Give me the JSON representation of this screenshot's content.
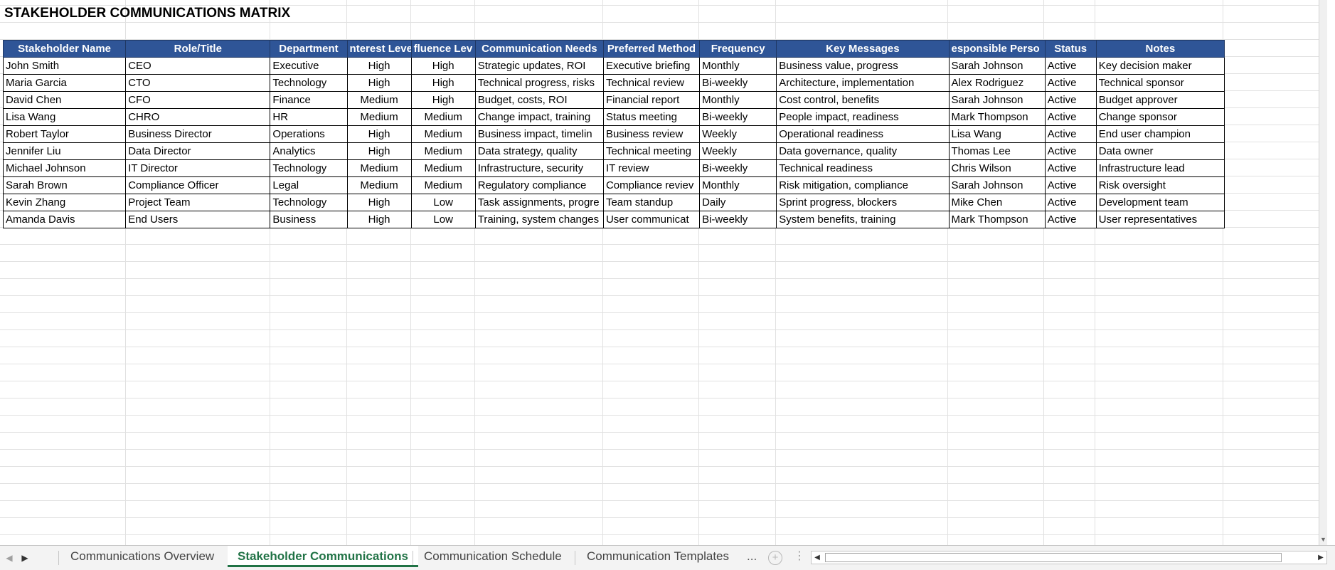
{
  "sheet": {
    "title": "STAKEHOLDER COMMUNICATIONS MATRIX",
    "header_color": "#2f5597",
    "columns": [
      "Stakeholder Name",
      "Role/Title",
      "Department",
      "nterest Leve",
      "fluence Lev",
      "Communication Needs",
      "Preferred Method",
      "Frequency",
      "Key Messages",
      "esponsible Perso",
      "Status",
      "Notes"
    ],
    "rows": [
      [
        "John Smith",
        "CEO",
        "Executive",
        "High",
        "High",
        "Strategic updates, ROI",
        "Executive briefing",
        "Monthly",
        "Business value, progress",
        "Sarah Johnson",
        "Active",
        "Key decision maker"
      ],
      [
        "Maria Garcia",
        "CTO",
        "Technology",
        "High",
        "High",
        "Technical progress, risks",
        "Technical review",
        "Bi-weekly",
        "Architecture, implementation",
        "Alex Rodriguez",
        "Active",
        "Technical sponsor"
      ],
      [
        "David Chen",
        "CFO",
        "Finance",
        "Medium",
        "High",
        "Budget, costs, ROI",
        "Financial report",
        "Monthly",
        "Cost control, benefits",
        "Sarah Johnson",
        "Active",
        "Budget approver"
      ],
      [
        "Lisa Wang",
        "CHRO",
        "HR",
        "Medium",
        "Medium",
        "Change impact, training",
        "Status meeting",
        "Bi-weekly",
        "People impact, readiness",
        "Mark Thompson",
        "Active",
        "Change sponsor"
      ],
      [
        "Robert Taylor",
        "Business Director",
        "Operations",
        "High",
        "Medium",
        "Business impact, timelin",
        "Business review",
        "Weekly",
        "Operational readiness",
        "Lisa Wang",
        "Active",
        "End user champion"
      ],
      [
        "Jennifer Liu",
        "Data Director",
        "Analytics",
        "High",
        "Medium",
        "Data strategy, quality",
        "Technical meeting",
        "Weekly",
        "Data governance, quality",
        "Thomas Lee",
        "Active",
        "Data owner"
      ],
      [
        "Michael Johnson",
        "IT Director",
        "Technology",
        "Medium",
        "Medium",
        "Infrastructure, security",
        "IT review",
        "Bi-weekly",
        "Technical readiness",
        "Chris Wilson",
        "Active",
        "Infrastructure lead"
      ],
      [
        "Sarah Brown",
        "Compliance Officer",
        "Legal",
        "Medium",
        "Medium",
        "Regulatory compliance",
        "Compliance reviev",
        "Monthly",
        "Risk mitigation, compliance",
        "Sarah Johnson",
        "Active",
        "Risk oversight"
      ],
      [
        "Kevin Zhang",
        "Project Team",
        "Technology",
        "High",
        "Low",
        "Task assignments, progre",
        "Team standup",
        "Daily",
        "Sprint progress, blockers",
        "Mike Chen",
        "Active",
        "Development team"
      ],
      [
        "Amanda Davis",
        "End Users",
        "Business",
        "High",
        "Low",
        "Training, system changes",
        "User communicat",
        "Bi-weekly",
        "System benefits, training",
        "Mark Thompson",
        "Active",
        "User representatives"
      ]
    ]
  },
  "tabs": {
    "items": [
      {
        "label": "Communications Overview",
        "active": false
      },
      {
        "label": "Stakeholder Communications",
        "active": true
      },
      {
        "label": "Communication Schedule",
        "active": false
      },
      {
        "label": "Communication Templates",
        "active": false
      }
    ],
    "more_label": "...",
    "add_symbol": "+",
    "active_color": "#217346"
  },
  "icons": {
    "prev_sheet": "triangle-left-icon",
    "next_sheet": "triangle-right-icon",
    "add_sheet": "plus-circle-icon",
    "scroll_left": "triangle-left-icon",
    "scroll_right": "triangle-right-icon",
    "scroll_down": "triangle-down-icon"
  }
}
